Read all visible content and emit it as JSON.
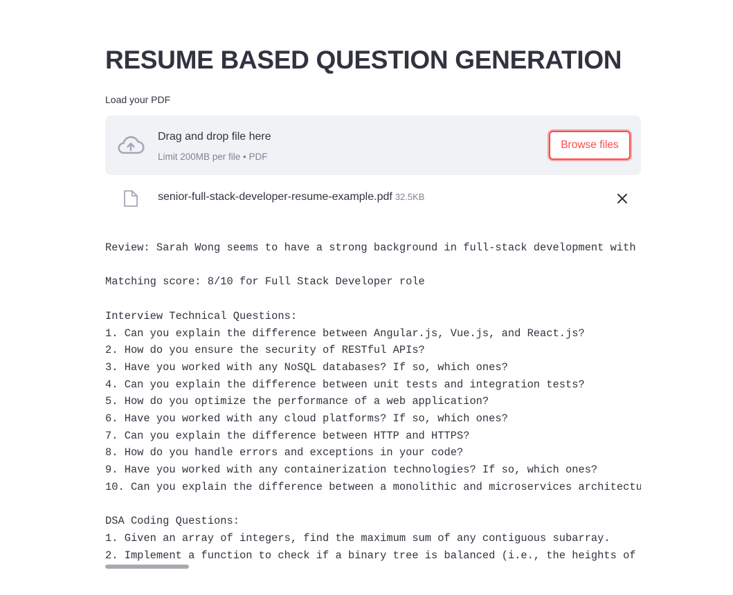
{
  "page": {
    "title": "RESUME BASED QUESTION GENERATION"
  },
  "uploader": {
    "label": "Load your PDF",
    "drop_text": "Drag and drop file here",
    "limit_text": "Limit 200MB per file • PDF",
    "browse_label": "Browse files",
    "icon": "cloud-upload-icon"
  },
  "uploaded_file": {
    "name": "senior-full-stack-developer-resume-example.pdf",
    "size": "32.5KB",
    "icon": "file-icon",
    "remove_icon": "close-icon"
  },
  "output": {
    "review": "Review: Sarah Wong seems to have a strong background in full-stack development with",
    "matching_score": "Matching score: 8/10 for Full Stack Developer role",
    "technical_heading": "Interview Technical Questions:",
    "technical_questions": [
      "1. Can you explain the difference between Angular.js, Vue.js, and React.js?",
      "2. How do you ensure the security of RESTful APIs?",
      "3. Have you worked with any NoSQL databases? If so, which ones?",
      "4. Can you explain the difference between unit tests and integration tests?",
      "5. How do you optimize the performance of a web application?",
      "6. Have you worked with any cloud platforms? If so, which ones?",
      "7. Can you explain the difference between HTTP and HTTPS?",
      "8. How do you handle errors and exceptions in your code?",
      "9. Have you worked with any containerization technologies? If so, which ones?",
      "10. Can you explain the difference between a monolithic and microservices architectu"
    ],
    "dsa_heading": "DSA Coding Questions:",
    "dsa_questions": [
      "1. Given an array of integers, find the maximum sum of any contiguous subarray.",
      "2. Implement a function to check if a binary tree is balanced (i.e., the heights of"
    ]
  },
  "colors": {
    "primary": "#ff4b4b",
    "text": "#31333f",
    "muted": "#808495",
    "dropzone_bg": "#f0f2f6",
    "scrollbar": "#a8a9ae"
  }
}
